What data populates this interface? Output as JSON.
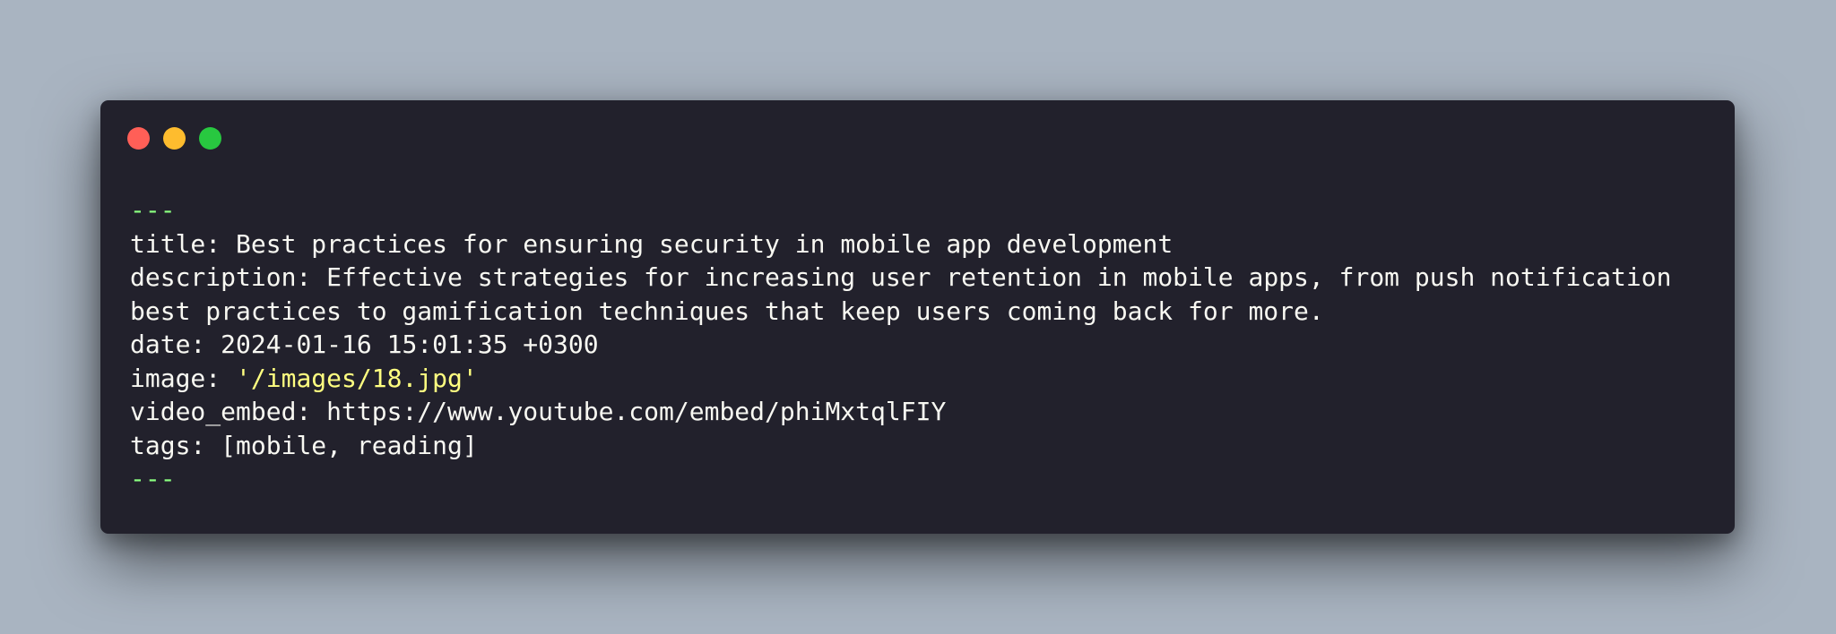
{
  "window": {
    "controls": [
      "close",
      "minimize",
      "maximize"
    ]
  },
  "colors": {
    "background": "#a9b4c1",
    "editor_bg": "#22212c",
    "text": "#f8f8f2",
    "delimiter": "#8aff80",
    "string": "#ffff80",
    "close": "#ff5f57",
    "minimize": "#febc2e",
    "maximize": "#28c840"
  },
  "frontmatter": {
    "open_delim": "---",
    "title_key": "title: ",
    "title_value": "Best practices for ensuring security in mobile app development",
    "description_key": "description: ",
    "description_value_line1": "Effective strategies for increasing user retention in mobile apps, from push notification",
    "description_value_line2": "best practices to gamification techniques that keep users coming back for more.",
    "date_key": "date: ",
    "date_value": "2024-01-16 15:01:35 +0300",
    "image_key": "image: ",
    "image_value": "'/images/18.jpg'",
    "video_key": "video_embed: ",
    "video_value": "https://www.youtube.com/embed/phiMxtqlFIY",
    "tags_key": "tags: ",
    "tags_value": "[mobile, reading]",
    "close_delim": "---"
  }
}
